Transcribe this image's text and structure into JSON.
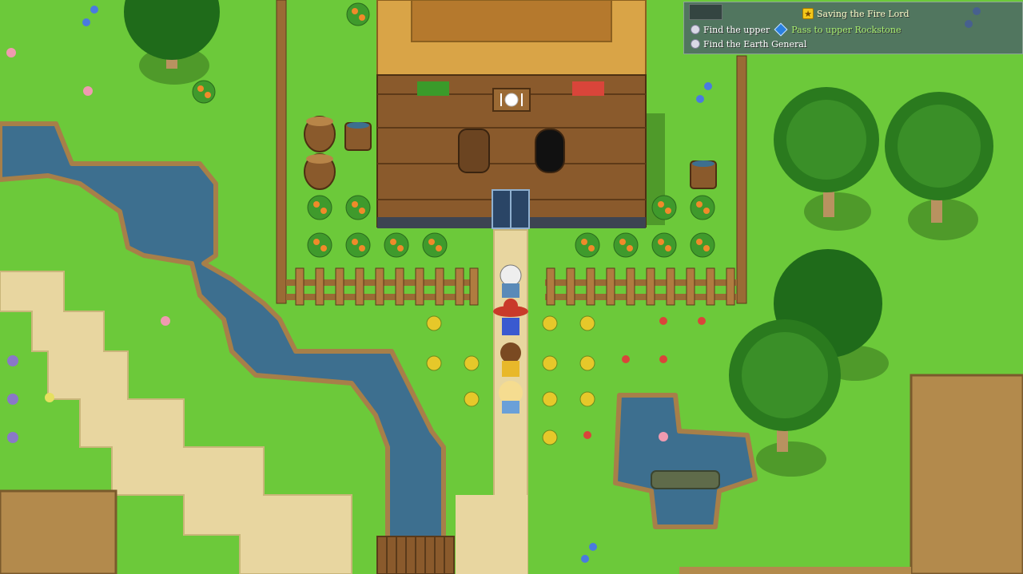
{
  "quest": {
    "title": "Saving the Fire Lord",
    "objectives": [
      {
        "text": "Find the upper",
        "hint": "Pass to upper Rockstone"
      },
      {
        "text": "Find the Earth General"
      }
    ]
  },
  "colors": {
    "grass": "#6cc93a",
    "water": "#3d6f8f",
    "dirt": "#e8d6a0",
    "wood": "#8a5a2c",
    "roof": "#d9a447",
    "cliff": "#b38a4c",
    "hud_bg": "#46566e",
    "hint_text": "#a8f070",
    "quest_title_text": "#ffffcc"
  },
  "icons": {
    "quest": "star-icon",
    "objective": "circle-icon",
    "hint": "crystal-icon",
    "sign": "plate-and-fork-icon"
  }
}
